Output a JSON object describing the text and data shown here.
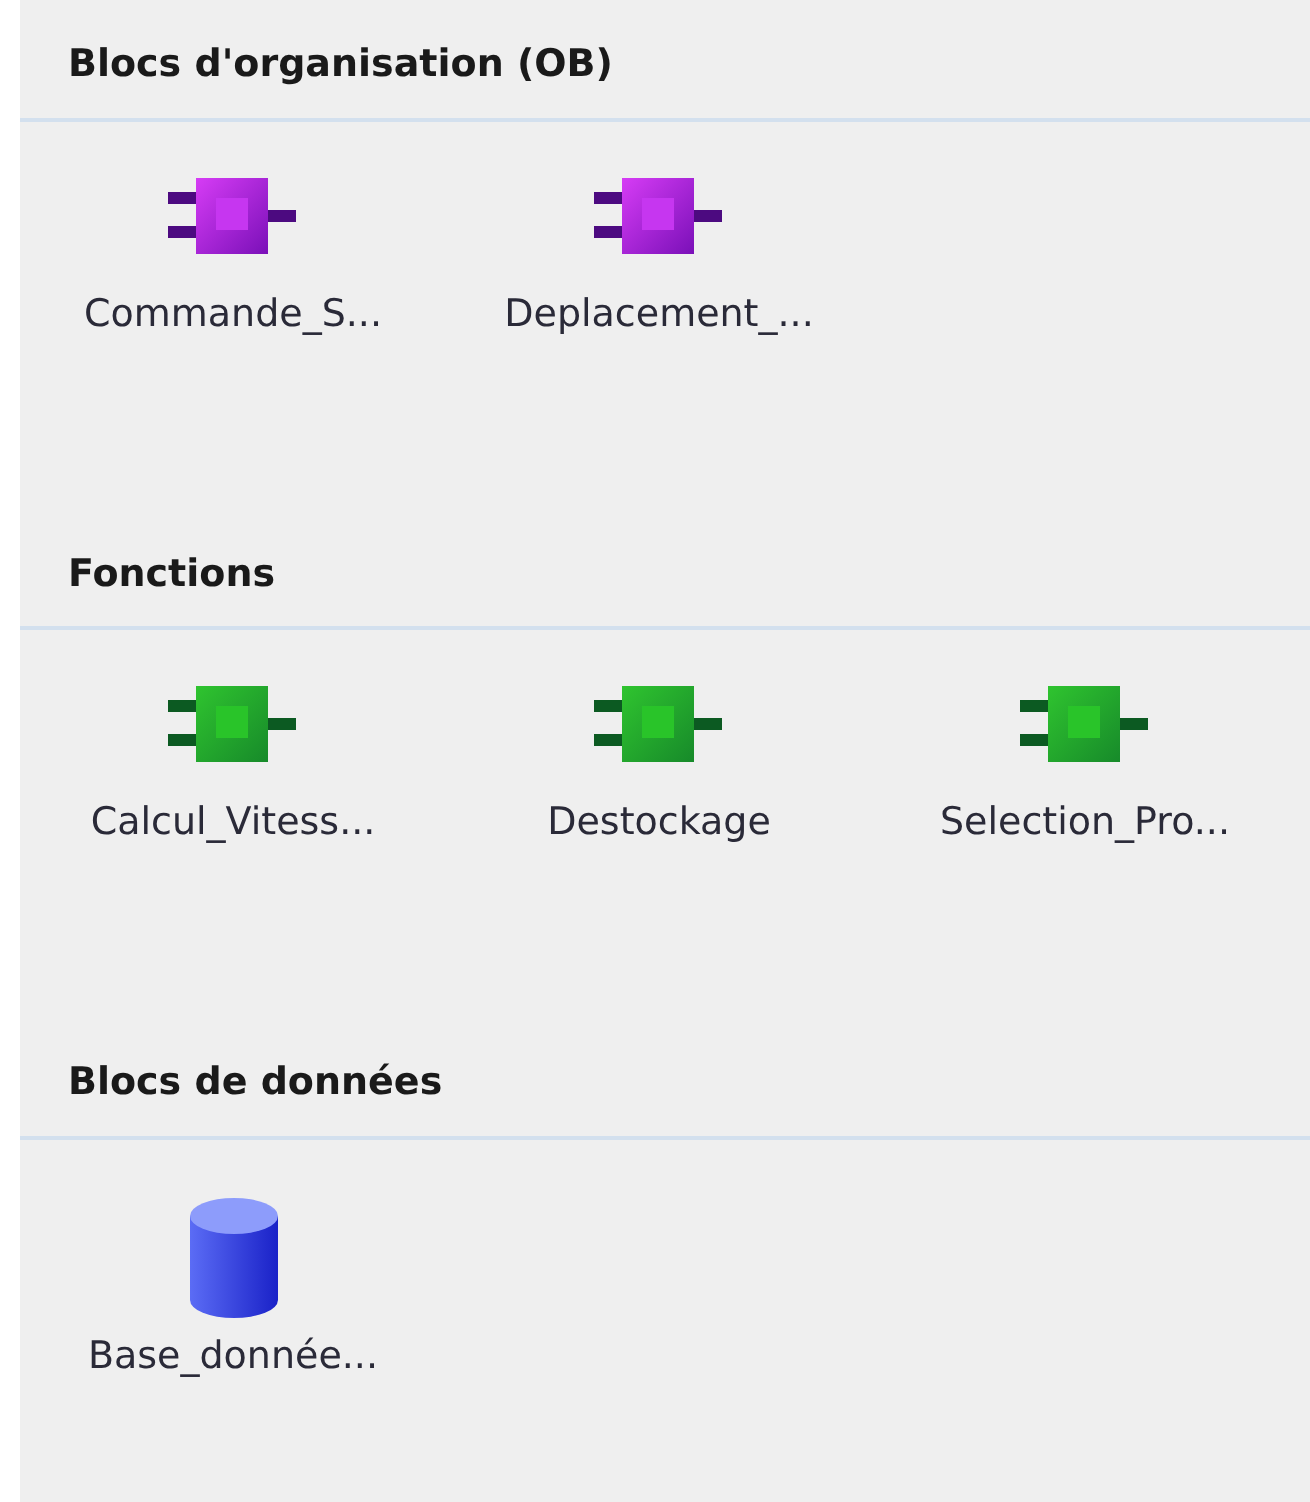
{
  "sections": [
    {
      "title": "Blocs d'organisation (OB)",
      "items": [
        {
          "label": "Commande_S...",
          "kind": "ob"
        },
        {
          "label": "Deplacement_...",
          "kind": "ob"
        }
      ]
    },
    {
      "title": "Fonctions",
      "items": [
        {
          "label": "Calcul_Vitess...",
          "kind": "fc"
        },
        {
          "label": "Destockage",
          "kind": "fc"
        },
        {
          "label": "Selection_Pro...",
          "kind": "fc"
        }
      ]
    },
    {
      "title": "Blocs de données",
      "items": [
        {
          "label": "Base_donnée...",
          "kind": "db"
        }
      ]
    }
  ]
}
